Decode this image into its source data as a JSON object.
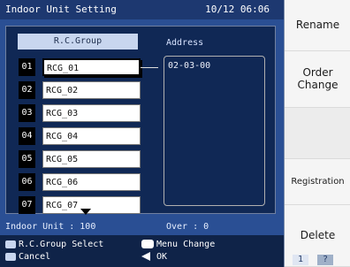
{
  "window": {
    "title": "Indoor Unit Setting",
    "datetime": "10/12 06:06"
  },
  "table": {
    "group_header": "R.C.Group",
    "address_header": "Address",
    "rows": [
      {
        "num": "01",
        "label": "RCG_01",
        "selected": true
      },
      {
        "num": "02",
        "label": "RCG_02",
        "selected": false
      },
      {
        "num": "03",
        "label": "RCG_03",
        "selected": false
      },
      {
        "num": "04",
        "label": "RCG_04",
        "selected": false
      },
      {
        "num": "05",
        "label": "RCG_05",
        "selected": false
      },
      {
        "num": "06",
        "label": "RCG_06",
        "selected": false
      },
      {
        "num": "07",
        "label": "RCG_07",
        "selected": false
      }
    ],
    "address_value": "02-03-00"
  },
  "summary": {
    "indoor_unit": "Indoor Unit : 100",
    "over": "Over : 0"
  },
  "status": {
    "rc_group_select": "R.C.Group Select",
    "menu_change": "Menu Change",
    "cancel": "Cancel",
    "ok": "OK"
  },
  "sidebar": {
    "rename": "Rename",
    "order_change_1": "Order",
    "order_change_2": "Change",
    "registration": "Registration",
    "delete": "Delete"
  },
  "pager": {
    "current": "1",
    "next": "?"
  }
}
